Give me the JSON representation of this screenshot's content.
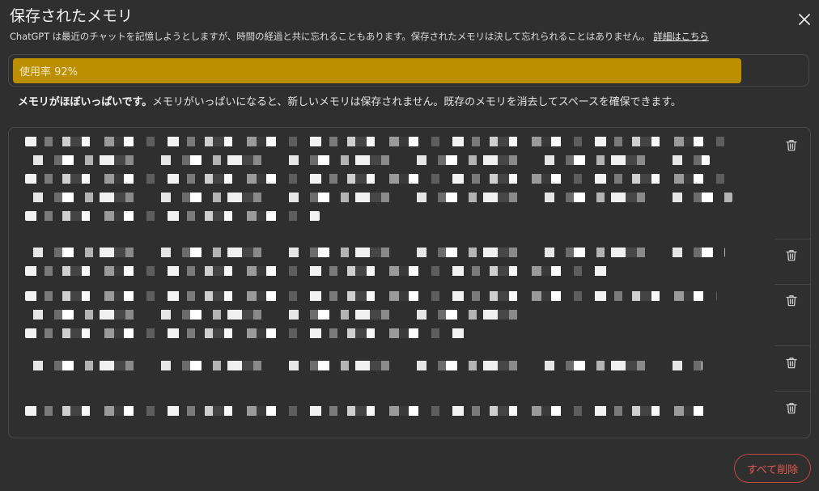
{
  "dialog": {
    "title": "保存されたメモリ",
    "description": "ChatGPT は最近のチャットを記憶しようとしますが、時間の経過と共に忘れることもあります。保存されたメモリは決して忘れられることはありません。",
    "learn_more": "詳細はこちら",
    "close_icon": "close-icon"
  },
  "usage": {
    "label": "使用率 92%",
    "percent": 92,
    "bar_color": "#bc8f00"
  },
  "notice": {
    "bold": "メモリがほぼいっぱいです。",
    "text": "メモリがいっぱいになると、新しいメモリは保存されません。既存のメモリを消去してスペースを確保できます。"
  },
  "memories": {
    "items": [
      {
        "lines": 5,
        "delete_icon": "trash-icon"
      },
      {
        "lines": 2,
        "delete_icon": "trash-icon"
      },
      {
        "lines": 3,
        "delete_icon": "trash-icon"
      },
      {
        "lines": 1,
        "delete_icon": "trash-icon"
      },
      {
        "lines": 1,
        "delete_icon": "trash-icon"
      }
    ]
  },
  "footer": {
    "delete_all_label": "すべて削除",
    "danger_color": "#e05a4f"
  }
}
